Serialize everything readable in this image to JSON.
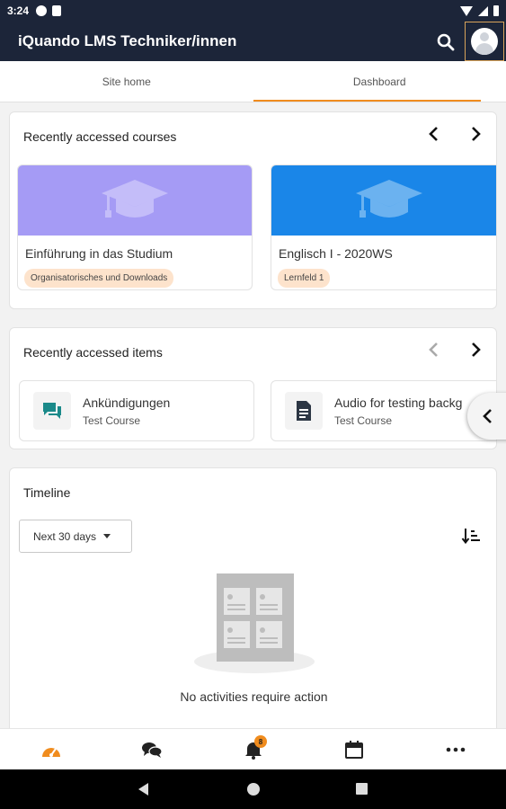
{
  "status_bar": {
    "time": "3:24"
  },
  "app": {
    "title": "iQuando LMS Techniker/innen"
  },
  "tabs": [
    {
      "label": "Site home",
      "active": false
    },
    {
      "label": "Dashboard",
      "active": true
    }
  ],
  "recent_courses": {
    "title": "Recently accessed courses",
    "courses": [
      {
        "name": "Einführung in das Studium",
        "category": "Organisatorisches und Downloads",
        "color": "#a59bf5"
      },
      {
        "name": "Englisch I - 2020WS",
        "category": "Lernfeld 1",
        "color": "#1a86e8"
      }
    ]
  },
  "recent_items": {
    "title": "Recently accessed items",
    "items": [
      {
        "name": "Ankündigungen",
        "course": "Test Course",
        "icon": "forum-icon"
      },
      {
        "name": "Audio for testing backg",
        "course": "Test Course",
        "icon": "document-icon"
      }
    ]
  },
  "timeline": {
    "title": "Timeline",
    "filter": "Next 30 days",
    "empty_message": "No activities require action"
  },
  "bottom_nav": {
    "notification_count": "8"
  },
  "colors": {
    "header": "#1c2539",
    "accent": "#f08c1e"
  }
}
